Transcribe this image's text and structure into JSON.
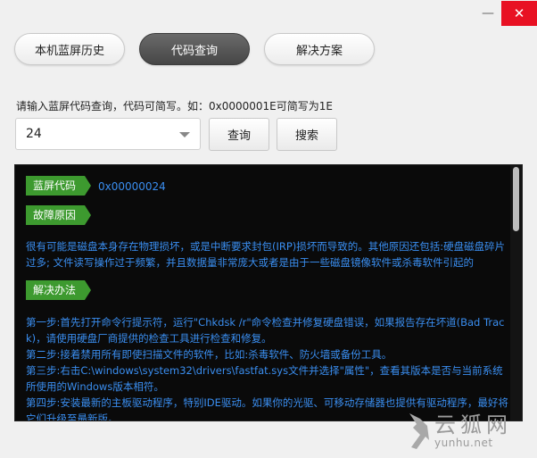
{
  "window": {
    "minimize_label": "—",
    "close_label": "✕"
  },
  "tabs": [
    {
      "label": "本机蓝屏历史",
      "active": false
    },
    {
      "label": "代码查询",
      "active": true
    },
    {
      "label": "解决方案",
      "active": false
    }
  ],
  "query": {
    "hint": "请输入蓝屏代码查询，代码可简写。如：0x0000001E可简写为1E",
    "code_value": "24",
    "query_button": "查询",
    "search_button": "搜索"
  },
  "result": {
    "code_tag": "蓝屏代码",
    "code_value": "0x00000024",
    "cause_tag": "故障原因",
    "cause_text": "很有可能是磁盘本身存在物理损坏，或是中断要求封包(IRP)损坏而导致的。其他原因还包括:硬盘磁盘碎片过多; 文件读写操作过于频繁，并且数据量非常庞大或者是由于一些磁盘镜像软件或杀毒软件引起的",
    "solution_tag": "解决办法",
    "solution_lines": [
      "第一步:首先打开命令行提示符，运行\"Chkdsk /r\"命令检查并修复硬盘错误，如果报告存在坏道(Bad Track)，请使用硬盘厂商提供的检查工具进行检查和修复。",
      "第二步:接着禁用所有即使扫描文件的软件，比如:杀毒软件、防火墙或备份工具。",
      "第三步:右击C:\\windows\\system32\\drivers\\fastfat.sys文件并选择\"属性\"，查看其版本是否与当前系统所使用的Windows版本相符。",
      "第四步:安装最新的主板驱动程序，特别IDE驱动。如果你的光驱、可移动存储器也提供有驱动程序，最好将它们升级至最新版。"
    ]
  },
  "watermark": {
    "title": "云狐网",
    "subtitle": "yunhu.net"
  },
  "colors": {
    "accent_green": "#3d9a2f",
    "text_blue": "#3a8ef0",
    "panel_bg": "#0a0a0a",
    "close_red": "#e81123"
  }
}
